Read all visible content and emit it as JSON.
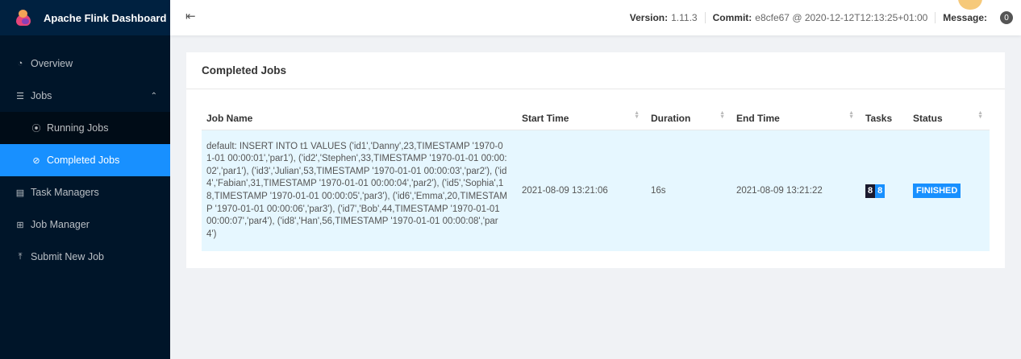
{
  "app": {
    "title": "Apache Flink Dashboard"
  },
  "sidebar": {
    "items": [
      {
        "label": "Overview",
        "icon": "dashboard-icon"
      },
      {
        "label": "Jobs",
        "icon": "list-icon"
      },
      {
        "label": "Running Jobs",
        "icon": "play-circle-icon"
      },
      {
        "label": "Completed Jobs",
        "icon": "check-circle-icon"
      },
      {
        "label": "Task Managers",
        "icon": "schedule-icon"
      },
      {
        "label": "Job Manager",
        "icon": "cluster-icon"
      },
      {
        "label": "Submit New Job",
        "icon": "upload-icon"
      }
    ]
  },
  "header": {
    "version_label": "Version:",
    "version": "1.11.3",
    "commit_label": "Commit:",
    "commit": "e8cfe67 @ 2020-12-12T12:13:25+01:00",
    "message_label": "Message:",
    "message_count": "0"
  },
  "card": {
    "title": "Completed Jobs",
    "columns": [
      "Job Name",
      "Start Time",
      "Duration",
      "End Time",
      "Tasks",
      "Status"
    ],
    "rows": [
      {
        "job_name": "default: INSERT INTO t1 VALUES ('id1','Danny',23,TIMESTAMP '1970-01-01 00:00:01','par1'), ('id2','Stephen',33,TIMESTAMP '1970-01-01 00:00:02','par1'), ('id3','Julian',53,TIMESTAMP '1970-01-01 00:00:03','par2'), ('id4','Fabian',31,TIMESTAMP '1970-01-01 00:00:04','par2'), ('id5','Sophia',18,TIMESTAMP '1970-01-01 00:00:05','par3'), ('id6','Emma',20,TIMESTAMP '1970-01-01 00:00:06','par3'), ('id7','Bob',44,TIMESTAMP '1970-01-01 00:00:07','par4'), ('id8','Han',56,TIMESTAMP '1970-01-01 00:00:08','par4')",
        "start_time": "2021-08-09 13:21:06",
        "duration": "16s",
        "end_time": "2021-08-09 13:21:22",
        "tasks_total": "8",
        "tasks_finished": "8",
        "status": "FINISHED"
      }
    ]
  },
  "colors": {
    "accent": "#1890ff",
    "sidebar": "#001529",
    "row_highlight": "#e6f7ff"
  }
}
